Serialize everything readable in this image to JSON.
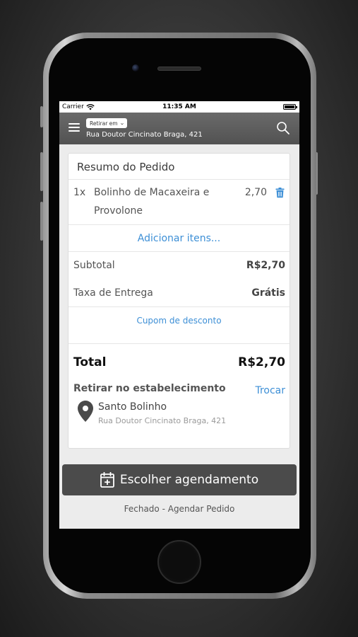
{
  "status_bar": {
    "carrier": "Carrier",
    "time": "11:35 AM"
  },
  "header": {
    "pickup_mode": "Retirar em",
    "address": "Rua Doutor Cincinato Braga, 421"
  },
  "order": {
    "title": "Resumo do Pedido",
    "items": [
      {
        "qty": "1x",
        "name": "Bolinho de Macaxeira e Provolone",
        "price": "2,70"
      }
    ],
    "add_items": "Adicionar itens...",
    "subtotal_label": "Subtotal",
    "subtotal_value": "R$2,70",
    "delivery_label": "Taxa de Entrega",
    "delivery_value": "Grátis",
    "coupon": "Cupom de desconto",
    "total_label": "Total",
    "total_value": "R$2,70"
  },
  "pickup": {
    "title": "Retirar no estabelecimento",
    "change": "Trocar",
    "store_name": "Santo Bolinho",
    "store_address": "Rua Doutor Cincinato Braga, 421"
  },
  "actions": {
    "schedule": "Escolher agendamento",
    "status": "Fechado - Agendar Pedido"
  },
  "colors": {
    "accent_link": "#3d8fd6",
    "header_bg": "#5e5e5e",
    "button_bg": "#4b4b4b"
  }
}
